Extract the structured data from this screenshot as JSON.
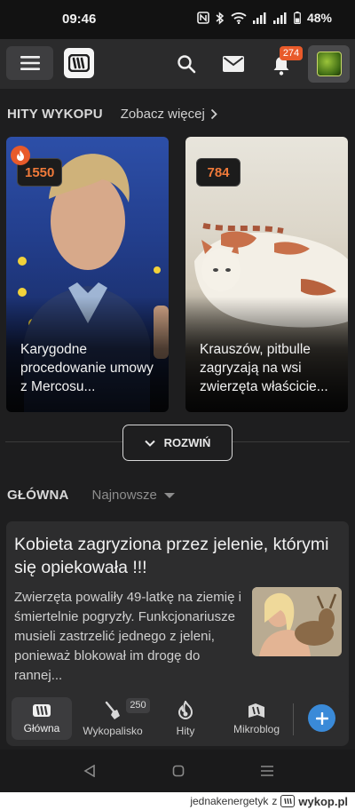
{
  "status_bar": {
    "time": "09:46",
    "battery": "48%"
  },
  "header": {
    "notifications_count": "274"
  },
  "hits": {
    "title": "HITY WYKOPU",
    "see_more": "Zobacz więcej",
    "cards": [
      {
        "score": "1550",
        "hot": true,
        "title": "Karygodne procedowanie umowy z Mercosu..."
      },
      {
        "score": "784",
        "hot": false,
        "title": "Krauszów, pitbulle zagryzają na wsi zwierzęta właścicie..."
      }
    ],
    "expand_label": "ROZWIŃ"
  },
  "main": {
    "title": "GŁÓWNA",
    "sort": "Najnowsze",
    "post": {
      "title": "Kobieta zagryziona przez jelenie, którymi się opiekowała !!!",
      "description": "Zwierzęta powaliły 49-latkę na ziemię i śmiertelnie pogryzły. Funkcjonariusze musieli zastrzelić jednego z jeleni, ponieważ blokował im drogę do rannej..."
    }
  },
  "bottom_nav": {
    "items": [
      {
        "label": "Główna",
        "icon": "wykop-home-icon",
        "active": true
      },
      {
        "label": "Wykopalisko",
        "icon": "shovel-icon",
        "count": "250"
      },
      {
        "label": "Hity",
        "icon": "flame-icon"
      },
      {
        "label": "Mikroblog",
        "icon": "microblog-icon"
      }
    ],
    "add_icon": "plus-icon"
  },
  "watermark": {
    "user": "jednakenergetyk",
    "sep": "z",
    "site": "wykop.pl"
  },
  "colors": {
    "accent": "#e85a2a",
    "score_text": "#f07a3a",
    "fab": "#3a8ad8"
  }
}
